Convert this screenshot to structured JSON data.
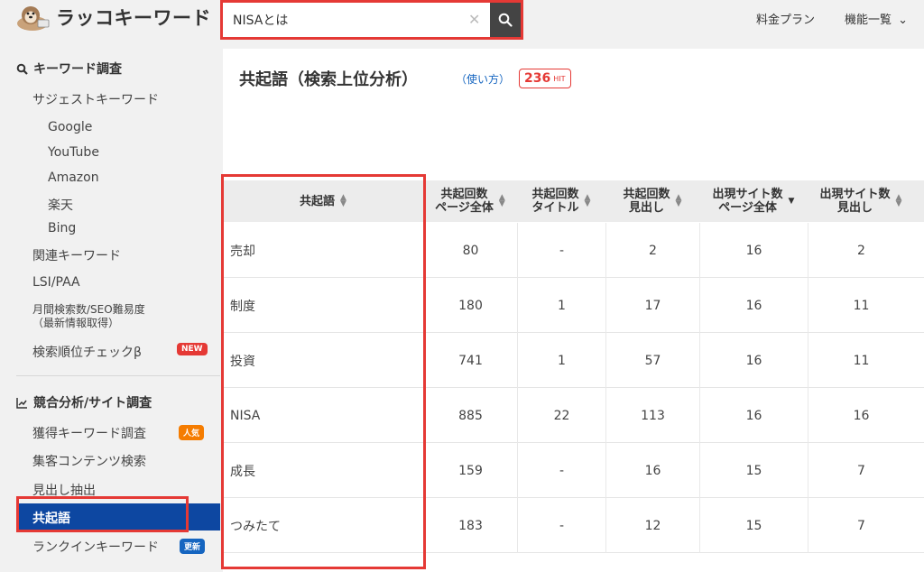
{
  "app": {
    "name": "ラッコキーワード"
  },
  "search": {
    "value": "NISAとは",
    "clear": "✕"
  },
  "nav": {
    "pricing": "料金プラン",
    "features": "機能一覧",
    "features_caret": "⌄"
  },
  "sidebar": {
    "sections": [
      {
        "title": "キーワード調査",
        "icon": "search-icon",
        "items": [
          {
            "label": "サジェストキーワード"
          },
          {
            "label": "Google",
            "sub": true
          },
          {
            "label": "YouTube",
            "sub": true
          },
          {
            "label": "Amazon",
            "sub": true
          },
          {
            "label": "楽天",
            "sub": true
          },
          {
            "label": "Bing",
            "sub": true
          },
          {
            "label": "関連キーワード"
          },
          {
            "label": "LSI/PAA"
          },
          {
            "label": "月間検索数/SEO難易度",
            "label2": "（最新情報取得）"
          },
          {
            "label": "検索順位チェックβ",
            "badge": "NEW",
            "badge_color": "#e53935"
          }
        ]
      },
      {
        "title": "競合分析/サイト調査",
        "icon": "chart-line-icon",
        "items": [
          {
            "label": "獲得キーワード調査",
            "badge": "人気",
            "badge_color": "#f57c00"
          },
          {
            "label": "集客コンテンツ検索"
          },
          {
            "label": "見出し抽出"
          },
          {
            "label": "共起語",
            "active": true
          },
          {
            "label": "ランクインキーワード",
            "badge": "更新",
            "badge_color": "#1565c0"
          }
        ]
      }
    ]
  },
  "main": {
    "title": "共起語（検索上位分析）",
    "howto": "（使い方）",
    "hit_count": "236",
    "hit_label": "HIT"
  },
  "table": {
    "headers": [
      {
        "l1": "共起語",
        "l2": ""
      },
      {
        "l1": "共起回数",
        "l2": "ページ全体"
      },
      {
        "l1": "共起回数",
        "l2": "タイトル"
      },
      {
        "l1": "共起回数",
        "l2": "見出し"
      },
      {
        "l1": "出現サイト数",
        "l2": "ページ全体"
      },
      {
        "l1": "出現サイト数",
        "l2": "見出し"
      }
    ],
    "rows": [
      [
        "売却",
        "80",
        "-",
        "2",
        "16",
        "2"
      ],
      [
        "制度",
        "180",
        "1",
        "17",
        "16",
        "11"
      ],
      [
        "投資",
        "741",
        "1",
        "57",
        "16",
        "11"
      ],
      [
        "NISA",
        "885",
        "22",
        "113",
        "16",
        "16"
      ],
      [
        "成長",
        "159",
        "-",
        "16",
        "15",
        "7"
      ],
      [
        "つみたて",
        "183",
        "-",
        "12",
        "15",
        "7"
      ]
    ]
  },
  "colors": {
    "accent_red": "#e53935",
    "active_nav": "#0d47a1",
    "link_blue": "#1565c0"
  }
}
